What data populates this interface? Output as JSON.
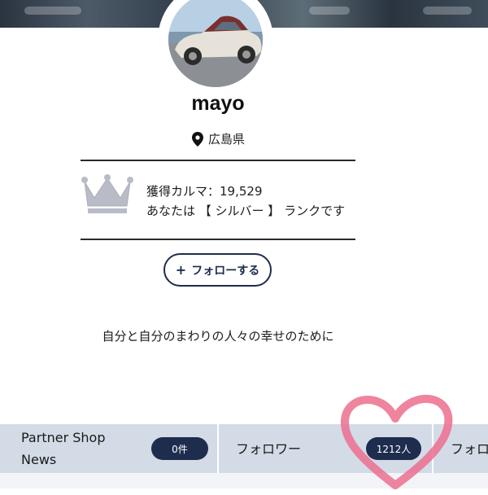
{
  "profile": {
    "username": "mayo",
    "location": "広島県",
    "karma_line": "獲得カルマ：19,529",
    "rank_line": "あなたは 【 シルバー 】 ランクです",
    "follow_button": "フォローする",
    "bio": "自分と自分のまわりの人々の幸せのために"
  },
  "stats": {
    "partner_shop_line1": "Partner Shop",
    "partner_shop_line2": "News",
    "partner_shop_count": "0件",
    "followers_label": "フォロワー",
    "followers_count": "1212人",
    "following_label_partial": "フォロ"
  },
  "icons": {
    "location": "map-pin-icon",
    "rank": "crown-icon",
    "follow": "plus-icon",
    "overlay": "heart-icon"
  },
  "colors": {
    "accent_navy": "#1e2d4e",
    "stats_bar_bg": "#d3dbe6",
    "crown_silver": "#b7bcc6",
    "heart_pink": "#ec6f8e"
  }
}
